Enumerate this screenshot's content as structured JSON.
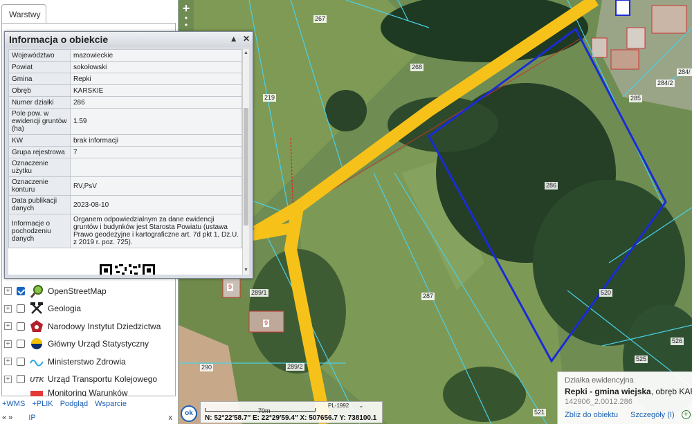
{
  "panel": {
    "tab_label": "Warstwy",
    "layers": [
      {
        "label": "OpenStreetMap",
        "checked": true,
        "icon": "magnifier-map-icon"
      },
      {
        "label": "Geologia",
        "checked": false,
        "icon": "crossed-hammers-icon"
      },
      {
        "label": "Narodowy Instytut Dziedzictwa",
        "checked": false,
        "icon": "heritage-emblem-icon"
      },
      {
        "label": "Główny Urząd Statystyczny",
        "checked": false,
        "icon": "gus-logo-icon"
      },
      {
        "label": "Ministerstwo Zdrowia",
        "checked": false,
        "icon": "health-wave-icon"
      },
      {
        "label": "Urząd Transportu Kolejowego",
        "checked": false,
        "icon": "utk-logo-icon"
      },
      {
        "label": "Monitoring Warunków",
        "checked": false,
        "icon": "monitoring-icon"
      }
    ],
    "links": [
      "+WMS",
      "+PLIK",
      "Podgląd",
      "Wsparcie"
    ],
    "bottom_nav": "«  »",
    "bottom_ip": "IP",
    "bottom_close": "x"
  },
  "zoom": {
    "in": "+",
    "dots": "•"
  },
  "info_popup": {
    "title": "Informacja o obiekcie",
    "minimize_icon": "▲",
    "close_icon": "✕",
    "rows": [
      {
        "key": "Województwo",
        "value": "mazowieckie"
      },
      {
        "key": "Powiat",
        "value": "sokołowski"
      },
      {
        "key": "Gmina",
        "value": "Repki"
      },
      {
        "key": "Obręb",
        "value": "KARSKIE"
      },
      {
        "key": "Numer działki",
        "value": "286"
      },
      {
        "key": "Pole pow. w ewidencji gruntów (ha)",
        "value": "1.59"
      },
      {
        "key": "KW",
        "value": "brak informacji"
      },
      {
        "key": "Grupa rejestrowa",
        "value": "7"
      },
      {
        "key": "Oznaczenie użytku",
        "value": ""
      },
      {
        "key": "Oznaczenie konturu",
        "value": "RV,PsV"
      },
      {
        "key": "Data publikacji danych",
        "value": "2023-08-10"
      },
      {
        "key": "Informacje o pochodzeniu danych",
        "value": "Organem odpowiedzialnym za dane ewidencji gruntów i budynków jest Starosta Powiatu (ustawa Prawo geodezyjne i kartograficzne art. 7d pkt 1, Dz.U. z 2019 r. poz. 725)."
      }
    ]
  },
  "map": {
    "parcel_labels": [
      "267",
      "268",
      "219",
      "285",
      "284/2",
      "284/",
      "286",
      "287",
      "289/1",
      "289/2",
      "290",
      "520",
      "525",
      "526",
      "521"
    ],
    "house_marker": "9",
    "road_color": "#f6c21a",
    "highlight_color": "#1a2bd6"
  },
  "status": {
    "ok_label": "ok",
    "scale_label": "70m",
    "crs": "PL-1992",
    "coords": "N: 52°22′58.7″  E: 22°29′59.4″  X: 507656.7  Y: 738100.1"
  },
  "parcel_box": {
    "heading": "Działka ewidencyjna",
    "name_bold": "Repki - gmina wiejska",
    "name_rest": ", obręb KARSKIE",
    "id": "142906_2.0012.286",
    "zoom_link": "Zbliż do obiektu",
    "details_link": "Szczegóły (I)",
    "plus": "+"
  }
}
